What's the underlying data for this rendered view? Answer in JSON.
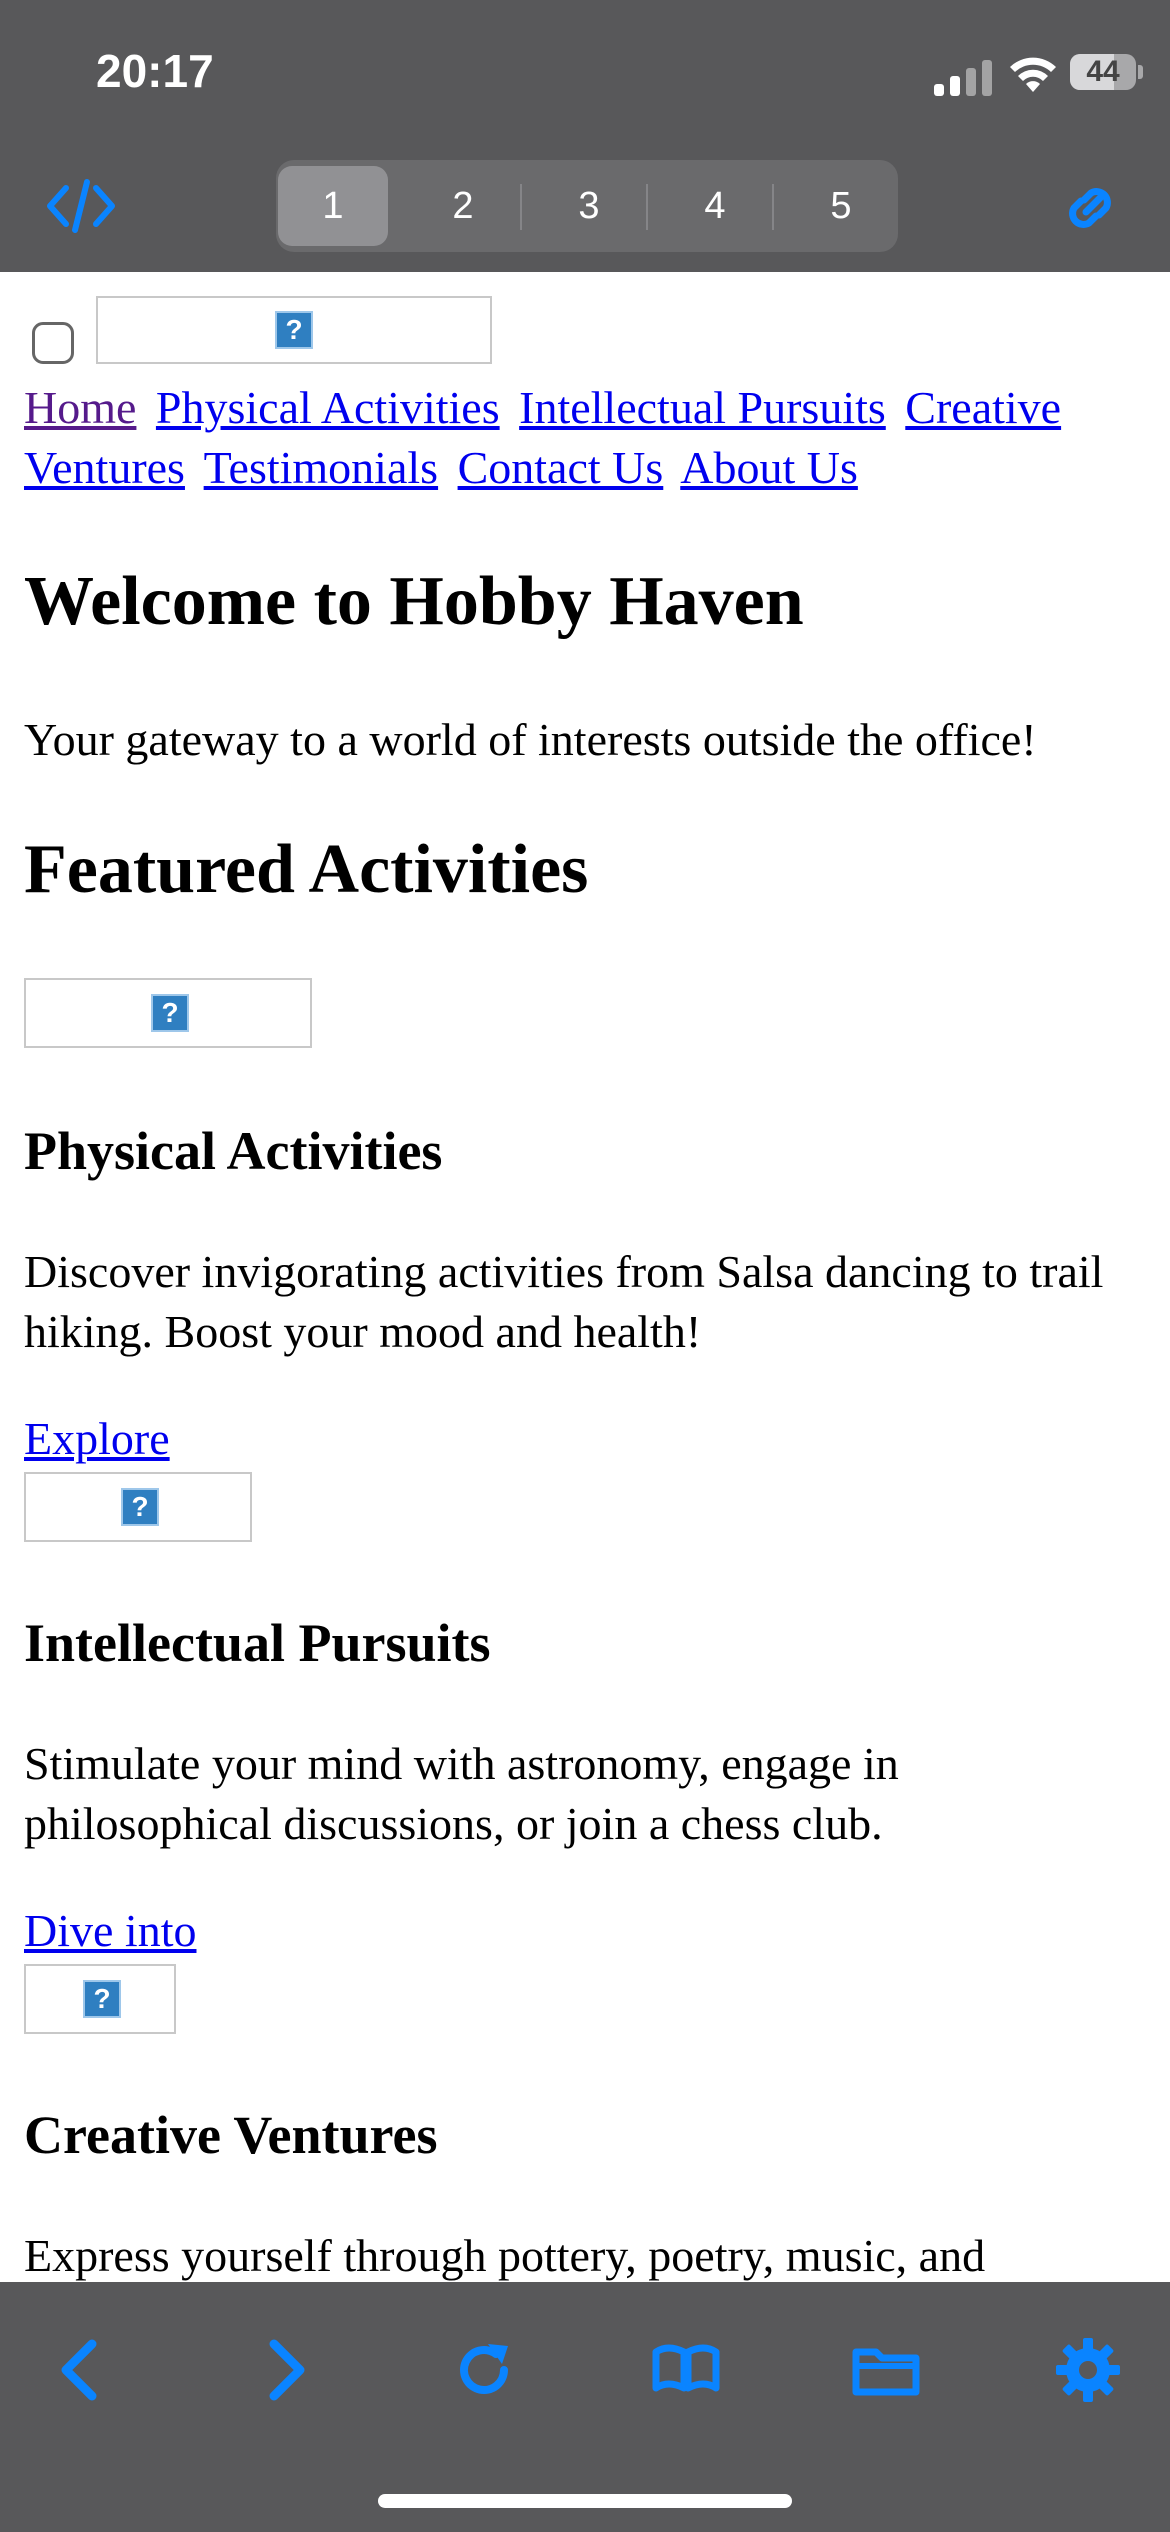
{
  "status_bar": {
    "time": "20:17",
    "battery": "44",
    "icons": [
      "signal-icon",
      "wifi-icon",
      "battery-icon"
    ]
  },
  "toolbar": {
    "left_icon": "code-icon",
    "right_icon": "link-icon",
    "tabs": [
      {
        "label": "1",
        "active": true
      },
      {
        "label": "2",
        "active": false
      },
      {
        "label": "3",
        "active": false
      },
      {
        "label": "4",
        "active": false
      },
      {
        "label": "5",
        "active": false
      }
    ]
  },
  "page": {
    "broken_image_glyph": "?",
    "nav": [
      "Home",
      "Physical Activities",
      "Intellectual Pursuits",
      "Creative Ventures",
      "Testimonials",
      "Contact Us",
      "About Us"
    ],
    "title": "Welcome to Hobby Haven",
    "tagline": "Your gateway to a world of interests outside the office!",
    "featured_heading": "Featured Activities",
    "sections": [
      {
        "heading": "Physical Activities",
        "text": "Discover invigorating activities from Salsa dancing to trail hiking. Boost your mood and health!",
        "link": "Explore"
      },
      {
        "heading": "Intellectual Pursuits",
        "text": "Stimulate your mind with astronomy, engage in philosophical discussions, or join a chess club.",
        "link": "Dive into"
      },
      {
        "heading": "Creative Ventures",
        "text": "Express yourself through pottery, poetry, music, and"
      }
    ]
  },
  "bottom_toolbar": {
    "icons": [
      "back-icon",
      "forward-icon",
      "reload-icon",
      "bookmarks-icon",
      "folder-icon",
      "settings-icon"
    ]
  },
  "colors": {
    "chrome": "#58585a",
    "accent": "#0a84ff",
    "link": "#0000ee",
    "visited": "#551a8b"
  }
}
